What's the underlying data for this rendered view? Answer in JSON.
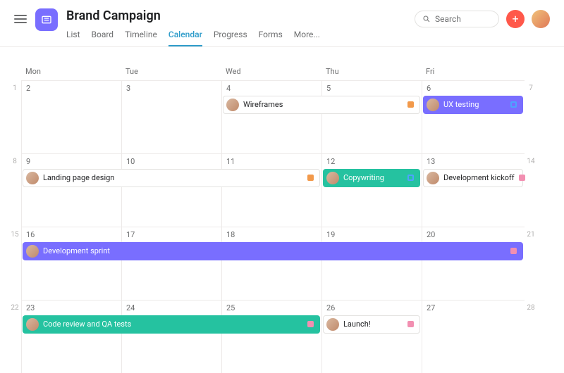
{
  "header": {
    "title": "Brand Campaign",
    "tabs": [
      "List",
      "Board",
      "Timeline",
      "Calendar",
      "Progress",
      "Forms",
      "More..."
    ],
    "active_tab_index": 3,
    "search_placeholder": "Search"
  },
  "calendar": {
    "day_headers": [
      "Mon",
      "Tue",
      "Wed",
      "Thu",
      "Fri"
    ],
    "weeks": [
      {
        "left_num": "1",
        "dates": [
          "2",
          "3",
          "4",
          "5",
          "6"
        ],
        "right_num": "7"
      },
      {
        "left_num": "8",
        "dates": [
          "9",
          "10",
          "11",
          "12",
          "13"
        ],
        "right_num": "14"
      },
      {
        "left_num": "15",
        "dates": [
          "16",
          "17",
          "18",
          "19",
          "20"
        ],
        "right_num": "21"
      },
      {
        "left_num": "22",
        "dates": [
          "23",
          "24",
          "25",
          "26",
          "27"
        ],
        "right_num": "28"
      }
    ]
  },
  "events": {
    "w0e0": {
      "label": "Wireframes",
      "style": "white",
      "badge": "orange"
    },
    "w0e1": {
      "label": "UX testing",
      "style": "purple",
      "badge": "blue-o"
    },
    "w1e0": {
      "label": "Landing page design",
      "style": "white",
      "badge": "orange"
    },
    "w1e1": {
      "label": "Copywriting",
      "style": "teal",
      "badge": "blue-o"
    },
    "w1e2": {
      "label": "Development kickoff",
      "style": "white",
      "badge": "pink"
    },
    "w2e0": {
      "label": "Development sprint",
      "style": "purple",
      "badge": "pink"
    },
    "w3e0": {
      "label": "Code review and QA tests",
      "style": "teal",
      "badge": "pink"
    },
    "w3e1": {
      "label": "Launch!",
      "style": "white",
      "badge": "pink"
    }
  },
  "icons": {
    "project": "list-icon",
    "search": "search-icon",
    "add": "plus-icon",
    "menu": "hamburger-icon",
    "avatar": "user-avatar"
  },
  "colors": {
    "purple": "#796eff",
    "teal": "#25c2a0",
    "orange": "#f2994a",
    "pink": "#f28fb1",
    "link": "#2e9cca"
  }
}
